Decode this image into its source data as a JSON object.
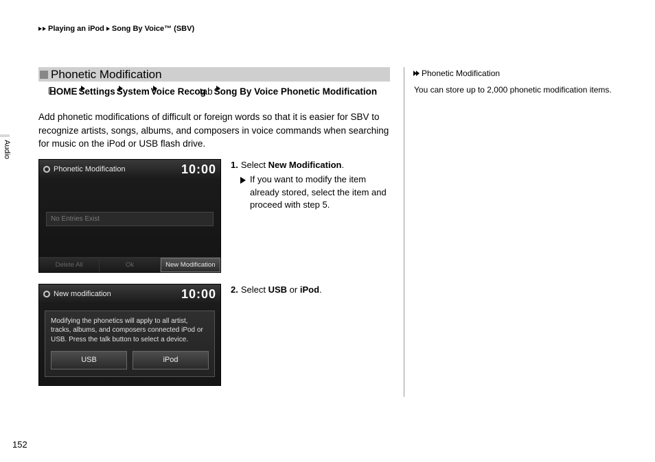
{
  "breadcrumb": {
    "parent": "Playing an iPod",
    "child": "Song By Voice™ (SBV)"
  },
  "section_title": "Phonetic Modification",
  "nav": {
    "home": "HOME",
    "settings": "Settings",
    "system": "System",
    "voice": "Voice Recog",
    "tab": "tab",
    "final": "Song By Voice Phonetic Modification"
  },
  "intro": "Add phonetic modifications of difficult or foreign words so that it is easier for SBV to recognize artists, songs, albums, and composers in voice commands when searching for music on the iPod or USB flash drive.",
  "shot1": {
    "title": "Phonetic Modification",
    "clock": "10:00",
    "no_entries": "No Entries Exist",
    "btn_delete": "Delete All",
    "btn_ok": "Ok",
    "btn_new": "New Modification"
  },
  "step1": {
    "num": "1.",
    "text_a": "Select ",
    "text_b": "New Modification",
    "text_c": ".",
    "sub": "If you want to modify the item already stored, select the item and proceed with step 5."
  },
  "shot2": {
    "title": "New modification",
    "clock": "10:00",
    "msg": "Modifying the phonetics will apply to all artist, tracks, albums, and composers connected iPod or USB. Press the talk button to select a device.",
    "btn_usb": "USB",
    "btn_ipod": "iPod"
  },
  "step2": {
    "num": "2.",
    "text_a": "Select ",
    "text_b": "USB",
    "text_c": " or ",
    "text_d": "iPod",
    "text_e": "."
  },
  "sidebar": {
    "title": "Phonetic Modification",
    "body": "You can store up to 2,000 phonetic modification items."
  },
  "side_tab": "Audio",
  "page_num": "152"
}
